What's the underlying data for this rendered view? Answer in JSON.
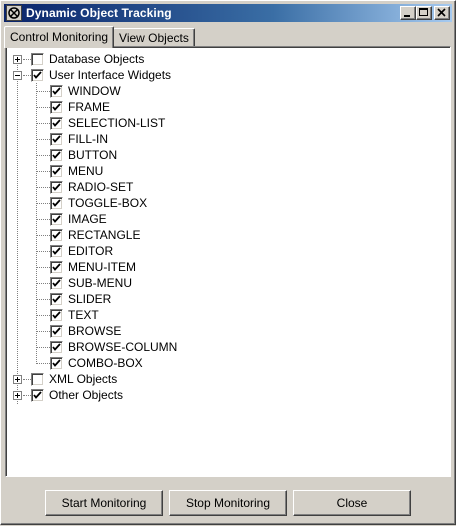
{
  "window": {
    "title": "Dynamic Object Tracking",
    "icon": "app-icon"
  },
  "tabs": [
    {
      "label": "Control Monitoring",
      "active": true
    },
    {
      "label": "View Objects",
      "active": false
    }
  ],
  "tree": {
    "database": {
      "label": "Database Objects",
      "checked": false,
      "expanded": false
    },
    "ui_widgets": {
      "label": "User Interface Widgets",
      "checked": true,
      "expanded": true,
      "children": [
        {
          "label": "WINDOW",
          "checked": true
        },
        {
          "label": "FRAME",
          "checked": true
        },
        {
          "label": "SELECTION-LIST",
          "checked": true
        },
        {
          "label": "FILL-IN",
          "checked": true
        },
        {
          "label": "BUTTON",
          "checked": true
        },
        {
          "label": "MENU",
          "checked": true
        },
        {
          "label": "RADIO-SET",
          "checked": true
        },
        {
          "label": "TOGGLE-BOX",
          "checked": true
        },
        {
          "label": "IMAGE",
          "checked": true
        },
        {
          "label": "RECTANGLE",
          "checked": true
        },
        {
          "label": "EDITOR",
          "checked": true
        },
        {
          "label": "MENU-ITEM",
          "checked": true
        },
        {
          "label": "SUB-MENU",
          "checked": true
        },
        {
          "label": "SLIDER",
          "checked": true
        },
        {
          "label": "TEXT",
          "checked": true
        },
        {
          "label": "BROWSE",
          "checked": true
        },
        {
          "label": "BROWSE-COLUMN",
          "checked": true
        },
        {
          "label": "COMBO-BOX",
          "checked": true
        }
      ]
    },
    "xml": {
      "label": "XML Objects",
      "checked": false,
      "expanded": false
    },
    "other": {
      "label": "Other Objects",
      "checked": true,
      "expanded": false
    }
  },
  "buttons": {
    "start": "Start Monitoring",
    "stop": "Stop Monitoring",
    "close": "Close"
  }
}
